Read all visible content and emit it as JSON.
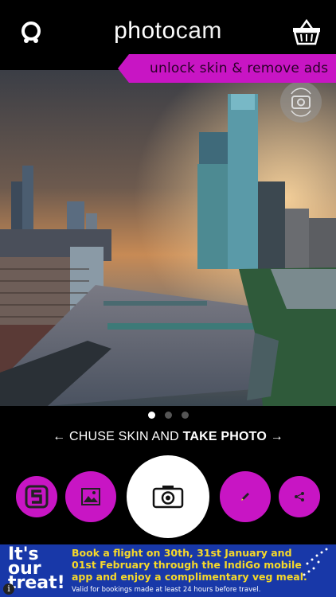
{
  "header": {
    "title_part1": "photo",
    "title_part2": "cam",
    "promo_text": "unlock skin & remove ads"
  },
  "icons": {
    "logo": "app-logo-icon",
    "basket": "basket-icon",
    "switch_camera": "switch-camera-icon",
    "skins": "skins-icon",
    "gallery": "gallery-icon",
    "shutter": "camera-icon",
    "edit": "pencil-icon",
    "share": "share-icon"
  },
  "pager": {
    "total": 3,
    "active": 1
  },
  "instruction": {
    "arrow_left": "←",
    "part1": "CHUSE SKIN AND",
    "part2": "TAKE PHOTO",
    "arrow_right": "→"
  },
  "ad": {
    "left_text": "It's our treat!",
    "main_text": "Book a flight on 30th, 31st January and 01st February through the IndiGo mobile app and enjoy a complimentary veg meal.",
    "fine_print": "Valid for bookings made at least 24 hours before travel.",
    "info": "i"
  },
  "colors": {
    "accent": "#c815c4",
    "background": "#000000",
    "ad_background": "#1838a8",
    "ad_text": "#f6d92a"
  }
}
